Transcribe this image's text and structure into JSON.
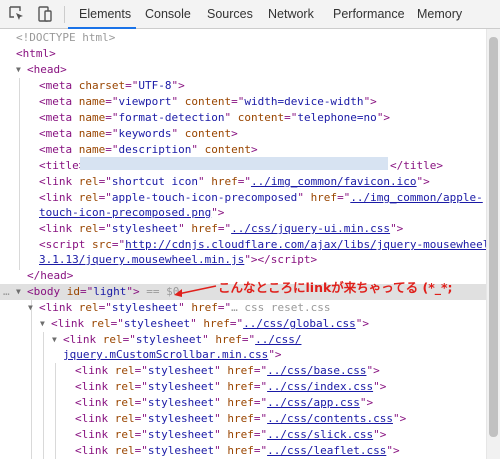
{
  "toolbar": {
    "icons": [
      "inspect-element-icon",
      "device-toggle-icon"
    ],
    "tabs": [
      "Elements",
      "Console",
      "Sources",
      "Network",
      "Performance",
      "Memory"
    ],
    "active_tab": "Elements"
  },
  "tree": {
    "doctype": "<!DOCTYPE html>",
    "html_open": "<html>",
    "head_open": "<head>",
    "meta_charset": {
      "tag": "meta",
      "attr": "charset",
      "value": "UTF-8"
    },
    "meta_viewport": {
      "name": "viewport",
      "content": "width=device-width"
    },
    "meta_format": {
      "name": "format-detection",
      "content": "telephone=no"
    },
    "meta_keywords": {
      "name": "keywords",
      "content": "content"
    },
    "meta_description": {
      "name": "description",
      "content": "content"
    },
    "title_open": "<title>",
    "title_close": "</title>",
    "link_icon": {
      "rel": "shortcut icon",
      "href": "../img_common/favicon.ico"
    },
    "link_touch": {
      "rel": "apple-touch-icon-precomposed",
      "href_1": "../img_common/apple-",
      "href_2": "touch-icon-precomposed.png"
    },
    "link_jqui": {
      "rel": "stylesheet",
      "href": "../css/jquery-ui.min.css"
    },
    "script": {
      "src_1": "http://cdnjs.cloudflare.com/ajax/libs/jquery-mousewheel/",
      "src_2": "3.1.13/jquery.mousewheel.min.js"
    },
    "head_close": "</head>",
    "body": {
      "id": "light",
      "marker": "== $0"
    },
    "link_reset": {
      "rel": "stylesheet",
      "href_text": "… css reset.css"
    },
    "link_global": {
      "rel": "stylesheet",
      "href": "../css/global.css"
    },
    "link_scroll": {
      "rel": "stylesheet",
      "href_1": "../css/",
      "href_2": "jquery.mCustomScrollbar.min.css"
    },
    "link_list": [
      {
        "rel": "stylesheet",
        "href": "../css/base.css"
      },
      {
        "rel": "stylesheet",
        "href": "../css/index.css"
      },
      {
        "rel": "stylesheet",
        "href": "../css/app.css"
      },
      {
        "rel": "stylesheet",
        "href": "../css/contents.css"
      },
      {
        "rel": "stylesheet",
        "href": "../css/slick.css"
      },
      {
        "rel": "stylesheet",
        "href": "../css/leaflet.css"
      }
    ]
  },
  "annotation": "こんなところにlinkが来ちゃってる (*_*;",
  "colors": {
    "annotation": "#e0201b",
    "tab_underline": "#1a73e8",
    "tag": "#881280",
    "attr": "#994500",
    "value": "#1a1aa6"
  }
}
